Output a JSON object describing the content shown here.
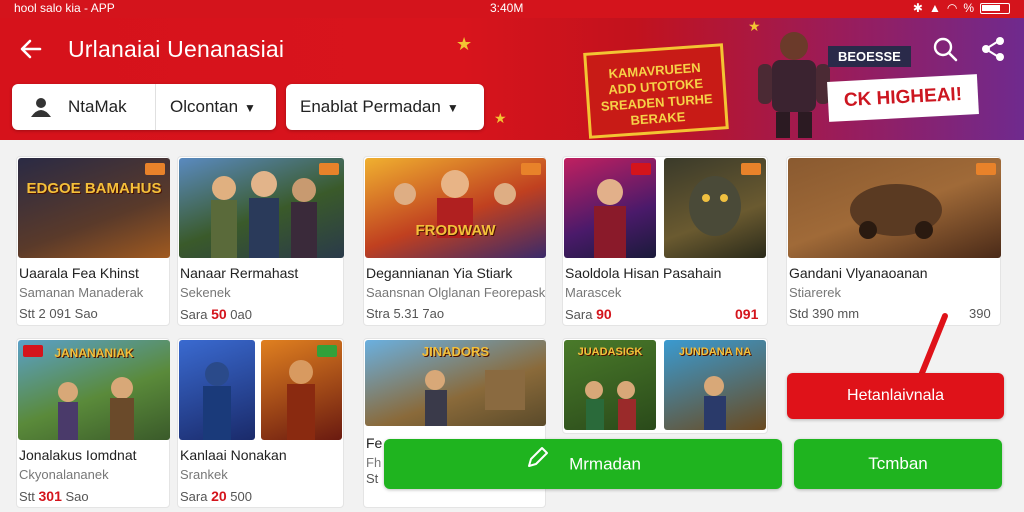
{
  "status_bar": {
    "left": "hool salo kia - APP",
    "time": "3:40M",
    "battery": "%"
  },
  "header": {
    "title": "Urlanaiai Uenanasiai",
    "filter1": {
      "chip": "",
      "label": "NtaMak",
      "value": "Olcontan"
    },
    "filter2": {
      "label": "Enablat Permadan"
    }
  },
  "banner": {
    "sign_lines": [
      "KAMAVRUEEN",
      "ADD UTOTOKE",
      "SREADEN TURHE",
      "BERAKE"
    ],
    "badge": "BEOESSE",
    "cta": "CK HIGHEAI!"
  },
  "cards": [
    {
      "id": "c1",
      "title": "Uaarala Fea Khinst",
      "sub": "Samanan Manaderak",
      "price_prefix": "Stt ",
      "price_value": "",
      "price_suffix": "2 091 Sao",
      "thumb_text": "EDGOE BAMAHUS",
      "badge_color": "#e8822a"
    },
    {
      "id": "c2",
      "title": "Nanaar Rermahast",
      "sub": "Sekenek",
      "price_prefix": "Sara ",
      "price_value": "50",
      "price_suffix": " 0a0",
      "thumb_text": "",
      "badge_color": "#e8822a"
    },
    {
      "id": "c3",
      "title": "Degannianan Yia Stiark",
      "sub": "Saansnan Olglanan Feorepask",
      "price_prefix": "Stra 5.31 7ao",
      "price_value": "",
      "price_suffix": "",
      "thumb_text": "FRODWAW",
      "badge_color": "#e8822a"
    },
    {
      "id": "c4",
      "title": "Saoldola Hisan Pasahain",
      "sub": "Marascek",
      "price_prefix": "Sara ",
      "price_value": "90",
      "price_suffix": "",
      "thumb_text": "",
      "badge_color": "#d4141c"
    },
    {
      "id": "c4b",
      "price_value2": "091"
    },
    {
      "id": "c5",
      "title": "Gandani Vlyanaoanan",
      "sub": "Stiarerek",
      "price_prefix": "Std 390 mm",
      "price_value": "",
      "price_suffix": "",
      "price_right": "390",
      "thumb_text": "",
      "badge_color": "#e8822a"
    },
    {
      "id": "c6",
      "title": "Jonalakus Iomdnat",
      "sub": "Ckyonalananek",
      "price_prefix": "Stt ",
      "price_value": "301",
      "price_suffix": " Sao",
      "thumb_text": "JANANANIAK",
      "badge_color": "#d4141c"
    },
    {
      "id": "c7",
      "title": "Kanlaai Nonakan",
      "sub": "Srankek",
      "price_prefix": "Sara ",
      "price_value": "20",
      "price_suffix": " 500",
      "thumb_text": "",
      "badge_color": "#31a13a"
    },
    {
      "id": "c8",
      "title": "Fe",
      "sub": "Fh",
      "price_prefix": "St",
      "price_value": "",
      "price_suffix": "",
      "thumb_text": "JINADORS",
      "badge_color": "#e8822a"
    },
    {
      "id": "c9",
      "thumb_text": "JUADASIGK",
      "thumb_text2": "JUNDANA NA"
    }
  ],
  "buttons": {
    "red": "Hetanlaivnala",
    "green_main": "Mrmadan",
    "green_side": "Tcmban"
  },
  "colors": {
    "primary_red": "#d4141c",
    "green": "#1fb41f",
    "price_red": "#d4141c"
  }
}
